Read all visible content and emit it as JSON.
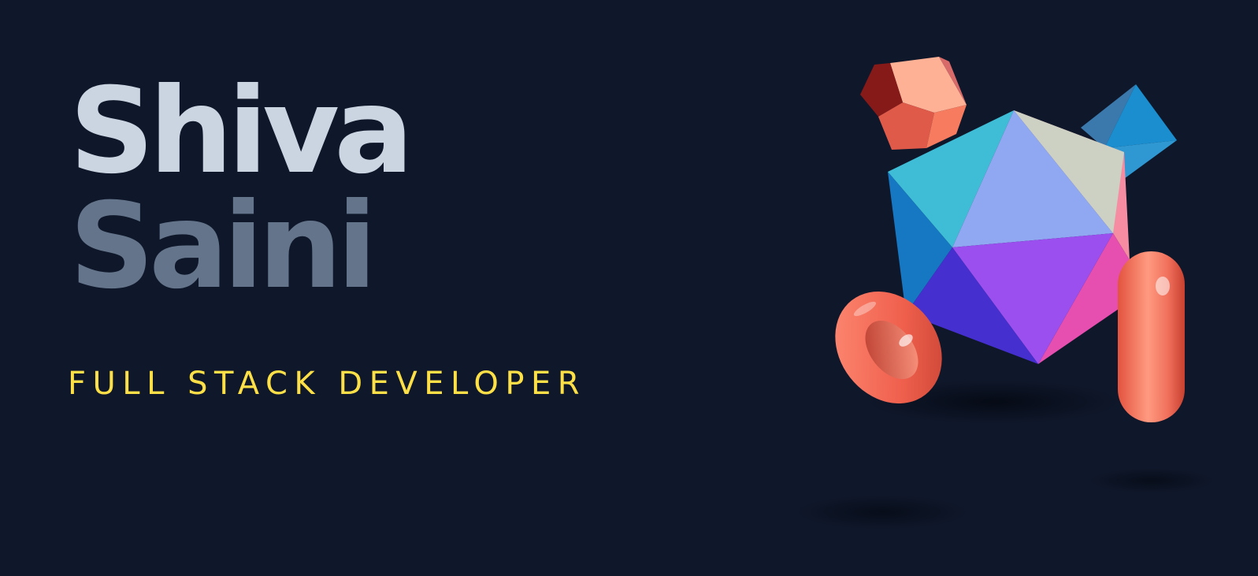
{
  "hero": {
    "name_first": "Shiva",
    "name_last": "Saini",
    "role": "FULL STACK DEVELOPER"
  },
  "colors": {
    "background": "#0f172a",
    "name_first": "#cbd5e1",
    "name_last": "#64748b",
    "role": "#fde047",
    "accent_coral": "#f97362"
  },
  "icons": [
    "icosahedron-shape",
    "dodecahedron-shape",
    "pyramid-shape",
    "torus-shape",
    "capsule-shape"
  ]
}
